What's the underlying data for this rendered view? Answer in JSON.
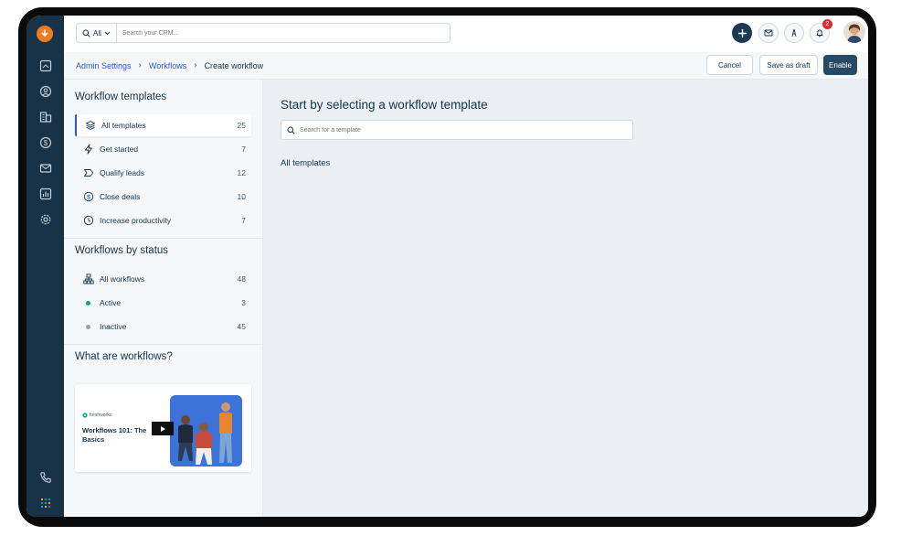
{
  "search": {
    "scope_label": "All",
    "placeholder": "Search your CRM..."
  },
  "topbar": {
    "notifications_count": "2"
  },
  "breadcrumb": {
    "items": [
      "Admin Settings",
      "Workflows"
    ],
    "current": "Create workflow"
  },
  "actions": {
    "cancel": "Cancel",
    "save_draft": "Save as draft",
    "enable": "Enable"
  },
  "sidebar": {
    "templates_title": "Workflow templates",
    "templates": [
      {
        "label": "All templates",
        "count": "25",
        "icon": "layers-icon"
      },
      {
        "label": "Get started",
        "count": "7",
        "icon": "bolt-icon"
      },
      {
        "label": "Qualify leads",
        "count": "12",
        "icon": "tag-icon"
      },
      {
        "label": "Close deals",
        "count": "10",
        "icon": "dollar-icon"
      },
      {
        "label": "Increase productivity",
        "count": "7",
        "icon": "clock-icon"
      }
    ],
    "status_title": "Workflows by status",
    "statuses": [
      {
        "label": "All workflows",
        "count": "48",
        "icon": "workflow-tree-icon"
      },
      {
        "label": "Active",
        "count": "3",
        "dot_color": "#00a886"
      },
      {
        "label": "Inactive",
        "count": "45",
        "dot_color": "#92a2b1"
      }
    ],
    "about_title": "What are workflows?",
    "video": {
      "brand": "freshworks",
      "title": "Workflows 101: The Basics"
    }
  },
  "main": {
    "title": "Start by selecting a workflow template",
    "search_placeholder": "Search for a template",
    "section_label": "All templates"
  },
  "colors": {
    "rail": "#183247",
    "accent": "#2c5cc5",
    "enable_button": "#264966",
    "logo": "#f07c1e",
    "badge": "#d72d30"
  }
}
